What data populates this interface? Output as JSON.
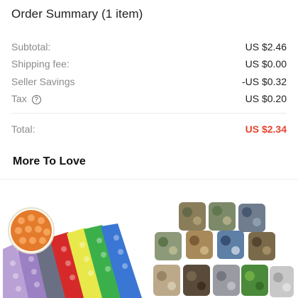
{
  "summary": {
    "title": "Order Summary (1 item)",
    "rows": [
      {
        "label": "Subtotal:",
        "value": "US $2.46"
      },
      {
        "label": "Shipping fee:",
        "value": "US $0.00"
      },
      {
        "label": "Seller Savings",
        "value": "-US $0.32"
      },
      {
        "label": "Tax",
        "value": "US $0.20",
        "help_icon": "?"
      }
    ],
    "total": {
      "label": "Total:",
      "value": "US $2.34"
    }
  },
  "more_to_love": {
    "title": "More To Love",
    "products": [
      {
        "icon": "foldable-seat-cushion-image"
      },
      {
        "icon": "camouflage-tape-rolls-image"
      }
    ]
  },
  "colors": {
    "total_price": "#e8432e",
    "label_gray": "#8a8a8a"
  }
}
